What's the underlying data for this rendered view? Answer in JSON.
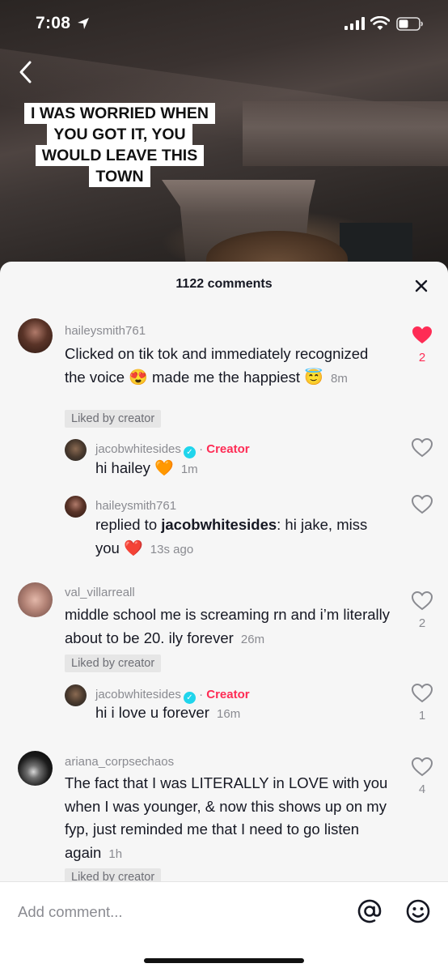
{
  "status_bar": {
    "time": "7:08"
  },
  "video": {
    "caption_lines": [
      "I WAS WORRIED WHEN",
      "YOU GOT IT, YOU",
      "WOULD LEAVE THIS",
      "TOWN"
    ]
  },
  "comments_panel": {
    "count_label": "1122 comments",
    "comments": [
      {
        "username": "haileysmith761",
        "text": "Clicked on tik tok and immediately recognized the voice",
        "emoji_1": "😍",
        "text_2": "made me the happiest",
        "emoji_2": "😇",
        "timestamp": "8m",
        "liked_by_creator": "Liked by creator",
        "likes": "2",
        "liked": true
      },
      {
        "username": "jacobwhitesides",
        "separator": "·",
        "creator_badge": "Creator",
        "text": "hi hailey",
        "emoji": "🧡",
        "timestamp": "1m"
      },
      {
        "username": "haileysmith761",
        "replied_prefix": "replied to",
        "replied_to": "jacobwhitesides",
        "text": ": hi jake, miss you",
        "emoji": "❤️",
        "timestamp": "13s ago"
      },
      {
        "username": "val_villarreall",
        "text": "middle school me is screaming rn and i’m literally about to be 20. ily forever",
        "timestamp": "26m",
        "liked_by_creator": "Liked by creator",
        "likes": "2"
      },
      {
        "username": "jacobwhitesides",
        "separator": "·",
        "creator_badge": "Creator",
        "text": "hi i love u forever",
        "timestamp": "16m",
        "likes": "1"
      },
      {
        "username": "ariana_corpsechaos",
        "text": "The fact that I was LITERALLY in LOVE with you when I was younger, & now this shows up on my fyp, just reminded me that I need to go listen again",
        "timestamp": "1h",
        "liked_by_creator": "Liked by creator",
        "likes": "4"
      }
    ]
  },
  "input": {
    "placeholder": "Add comment..."
  },
  "colors": {
    "accent": "#fe2c55",
    "verified": "#20d5ec",
    "sheet_bg": "#f6f6f6"
  },
  "icons": [
    "location-arrow-icon",
    "signal-icon",
    "wifi-icon",
    "battery-icon",
    "back-chevron-icon",
    "close-icon",
    "heart-icon",
    "verified-icon",
    "at-icon",
    "smiley-icon"
  ]
}
